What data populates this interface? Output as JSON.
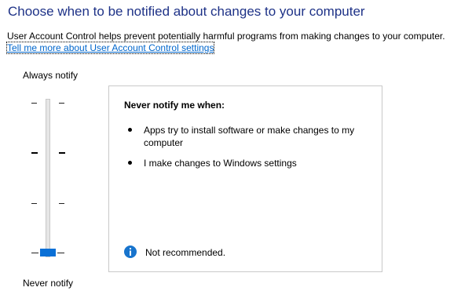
{
  "header": {
    "title": "Choose when to be notified about changes to your computer",
    "description": "User Account Control helps prevent potentially harmful programs from making changes to your computer.",
    "link_text": "Tell me more about User Account Control settings"
  },
  "slider": {
    "top_label": "Always notify",
    "bottom_label": "Never notify",
    "levels": 4,
    "selected_level": 1,
    "selected_level_note": "level 1 = bottom (Never notify), level 4 = top (Always notify)"
  },
  "info_panel": {
    "heading": "Never notify me when:",
    "bullets": [
      "Apps try to install software or make changes to my computer",
      "I make changes to Windows settings"
    ],
    "status_text": "Not recommended."
  },
  "colors": {
    "title": "#1e3287",
    "link": "#0066cc",
    "thumb": "#0a70d6",
    "info_icon": "#1874cd"
  },
  "icons": {
    "status": "info-icon"
  }
}
